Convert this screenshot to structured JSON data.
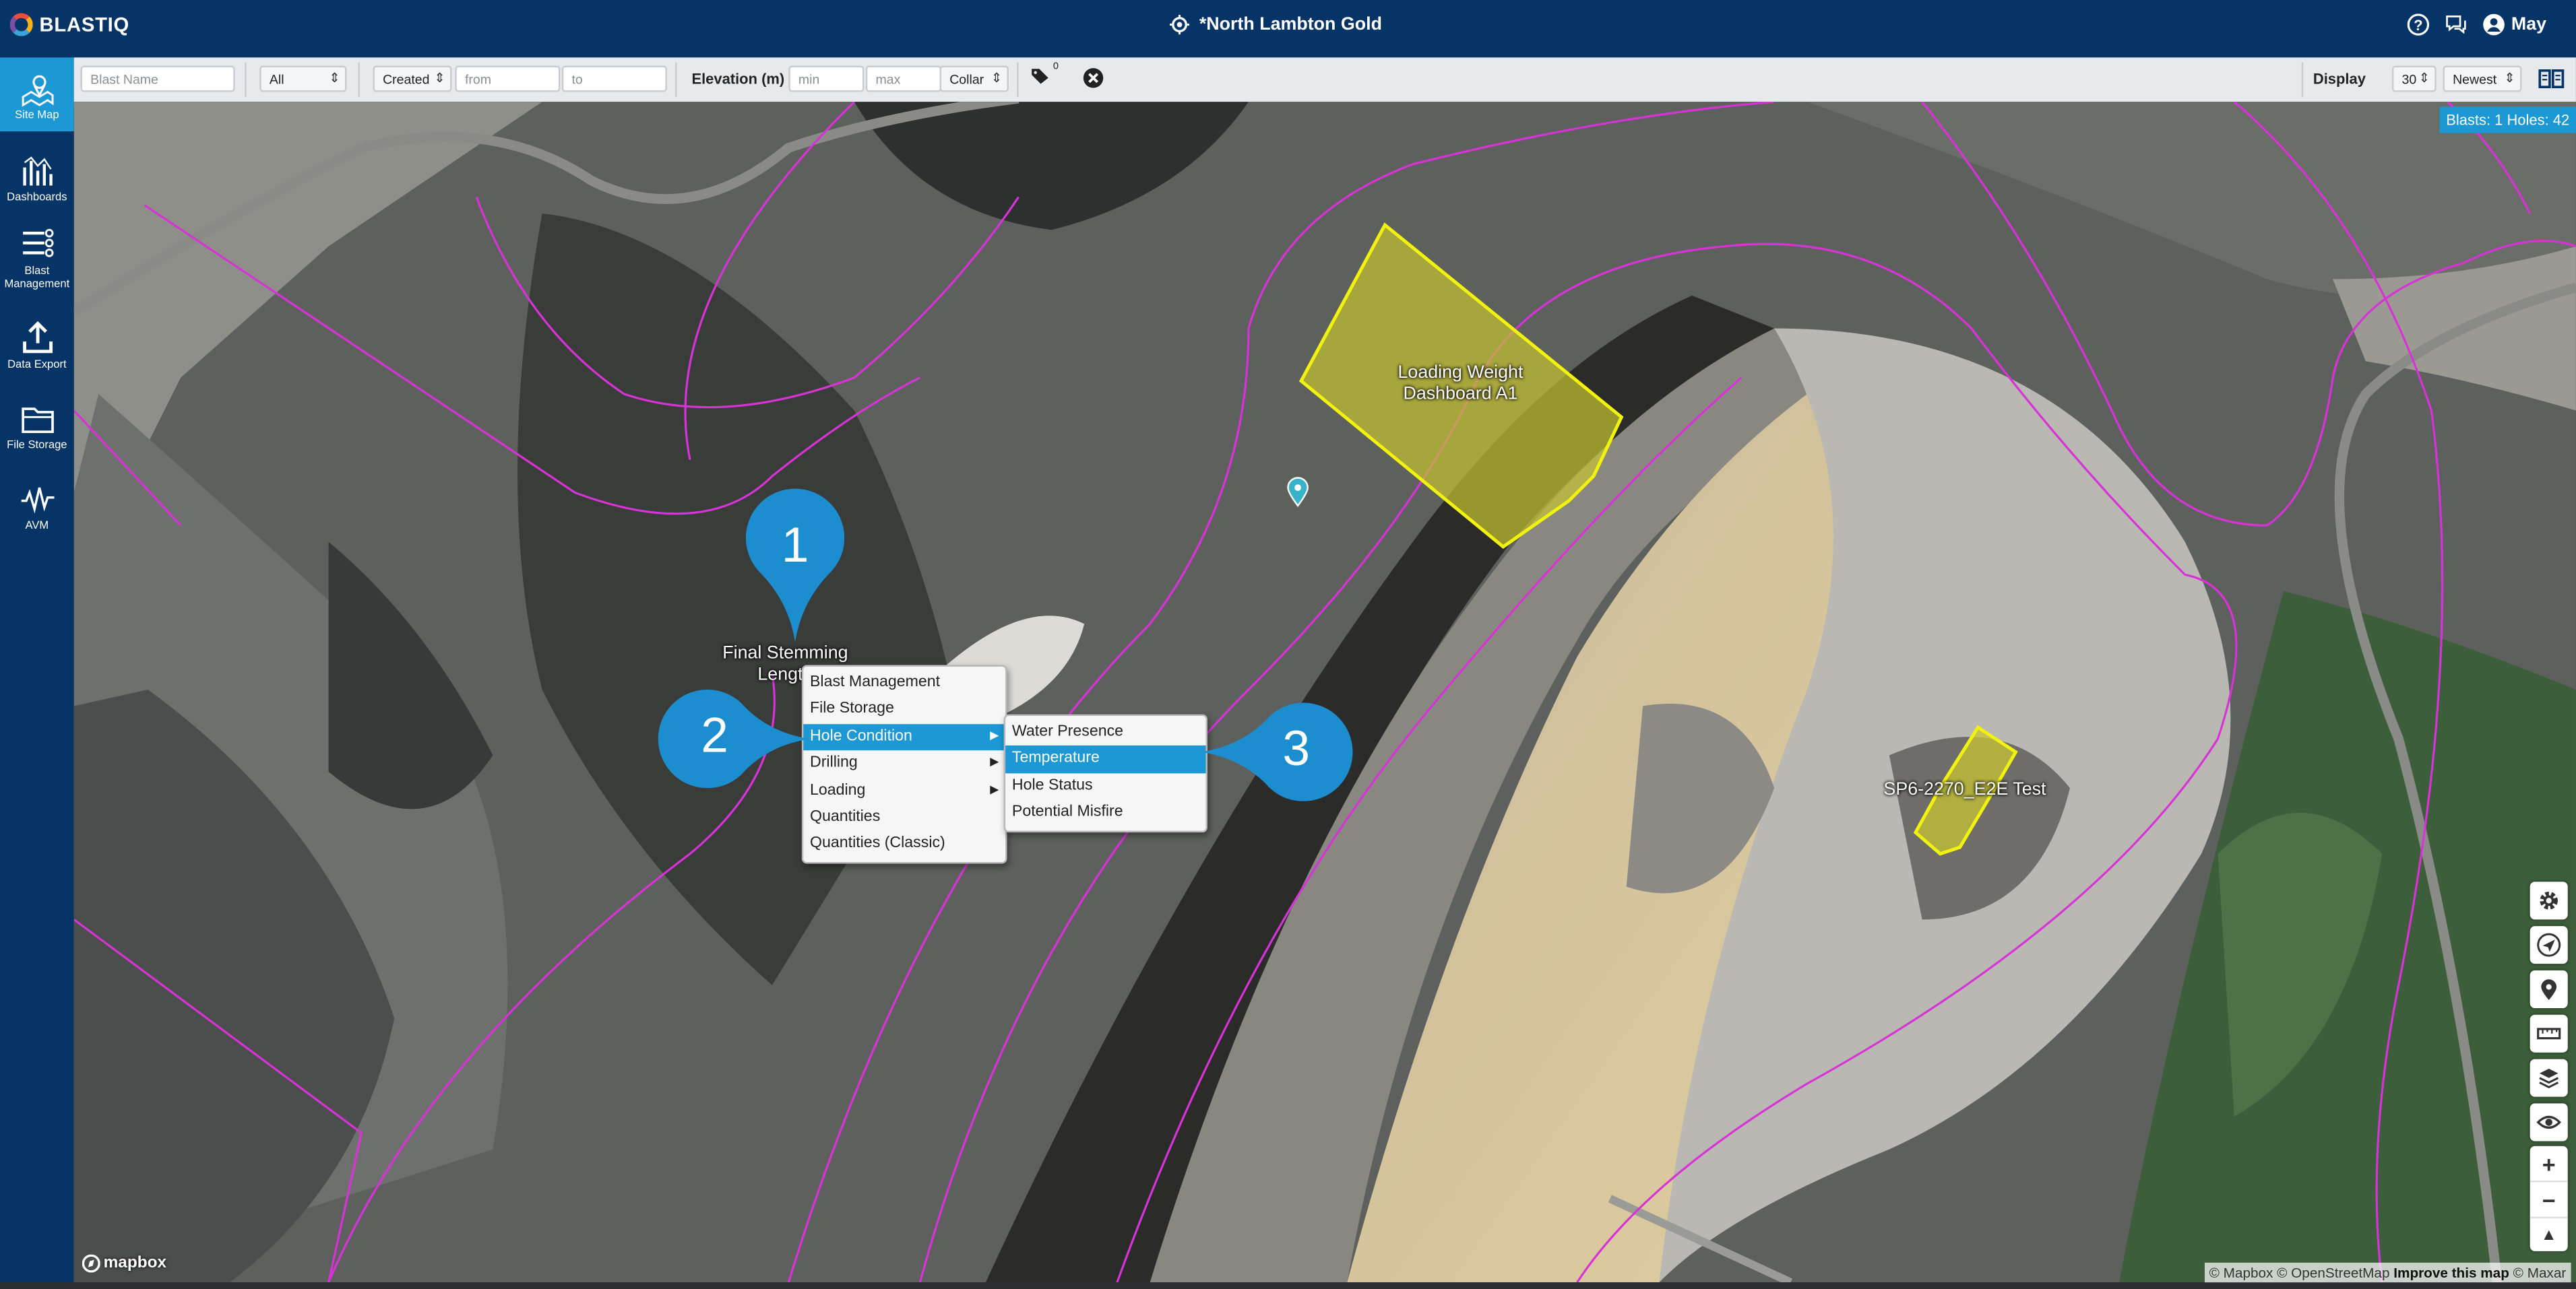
{
  "app": {
    "logo_text": "BLASTIQ",
    "site_name": "*North Lambton Gold",
    "user_name": "May"
  },
  "sidebar": {
    "items": [
      {
        "label": "Site Map",
        "icon": "site-map-icon"
      },
      {
        "label": "Dashboards",
        "icon": "dashboards-icon"
      },
      {
        "label": "Blast Management",
        "icon": "blast-management-icon"
      },
      {
        "label": "Data Export",
        "icon": "data-export-icon"
      },
      {
        "label": "File Storage",
        "icon": "file-storage-icon"
      },
      {
        "label": "AVM",
        "icon": "avm-icon"
      }
    ]
  },
  "filters": {
    "blast_name_placeholder": "Blast Name",
    "status_value": "All",
    "date_type_value": "Created",
    "from_placeholder": "from",
    "to_placeholder": "to",
    "elevation_label": "Elevation (m)",
    "min_placeholder": "min",
    "max_placeholder": "max",
    "elevation_ref_value": "Collar",
    "tag_count": "0",
    "display_label": "Display",
    "display_count_value": "30",
    "sort_value": "Newest"
  },
  "map": {
    "counter_text": "Blasts: 1 Holes: 42",
    "polygon_labels": [
      {
        "line1": "Loading Weight",
        "line2": "Dashboard A1"
      },
      {
        "line1": "SP6-2270_E2E Test",
        "line2": ""
      }
    ],
    "partial_label_line1": "Final Stemming",
    "partial_label_line2": "Length",
    "mapbox_logo": "mapbox",
    "attribution_prefix": "© Mapbox © OpenStreetMap",
    "attribution_improve": "Improve this map",
    "attribution_suffix": "© Maxar"
  },
  "context_menu": {
    "items": [
      {
        "label": "Blast Management",
        "has_submenu": false,
        "highlighted": false
      },
      {
        "label": "File Storage",
        "has_submenu": false,
        "highlighted": false
      },
      {
        "label": "Hole Condition",
        "has_submenu": true,
        "highlighted": true
      },
      {
        "label": "Drilling",
        "has_submenu": true,
        "highlighted": false
      },
      {
        "label": "Loading",
        "has_submenu": true,
        "highlighted": false
      },
      {
        "label": "Quantities",
        "has_submenu": false,
        "highlighted": false
      },
      {
        "label": "Quantities (Classic)",
        "has_submenu": false,
        "highlighted": false
      }
    ]
  },
  "submenu": {
    "items": [
      {
        "label": "Water Presence",
        "highlighted": false
      },
      {
        "label": "Temperature",
        "highlighted": true
      },
      {
        "label": "Hole Status",
        "highlighted": false
      },
      {
        "label": "Potential Misfire",
        "highlighted": false
      }
    ]
  },
  "callouts": [
    "1",
    "2",
    "3"
  ],
  "colors": {
    "header_bg": "#063466",
    "accent": "#1c98d5",
    "boundary_line": "#d733d6",
    "blast_polygon_fill": "#c7c531",
    "blast_polygon_stroke": "#f2f20f"
  }
}
